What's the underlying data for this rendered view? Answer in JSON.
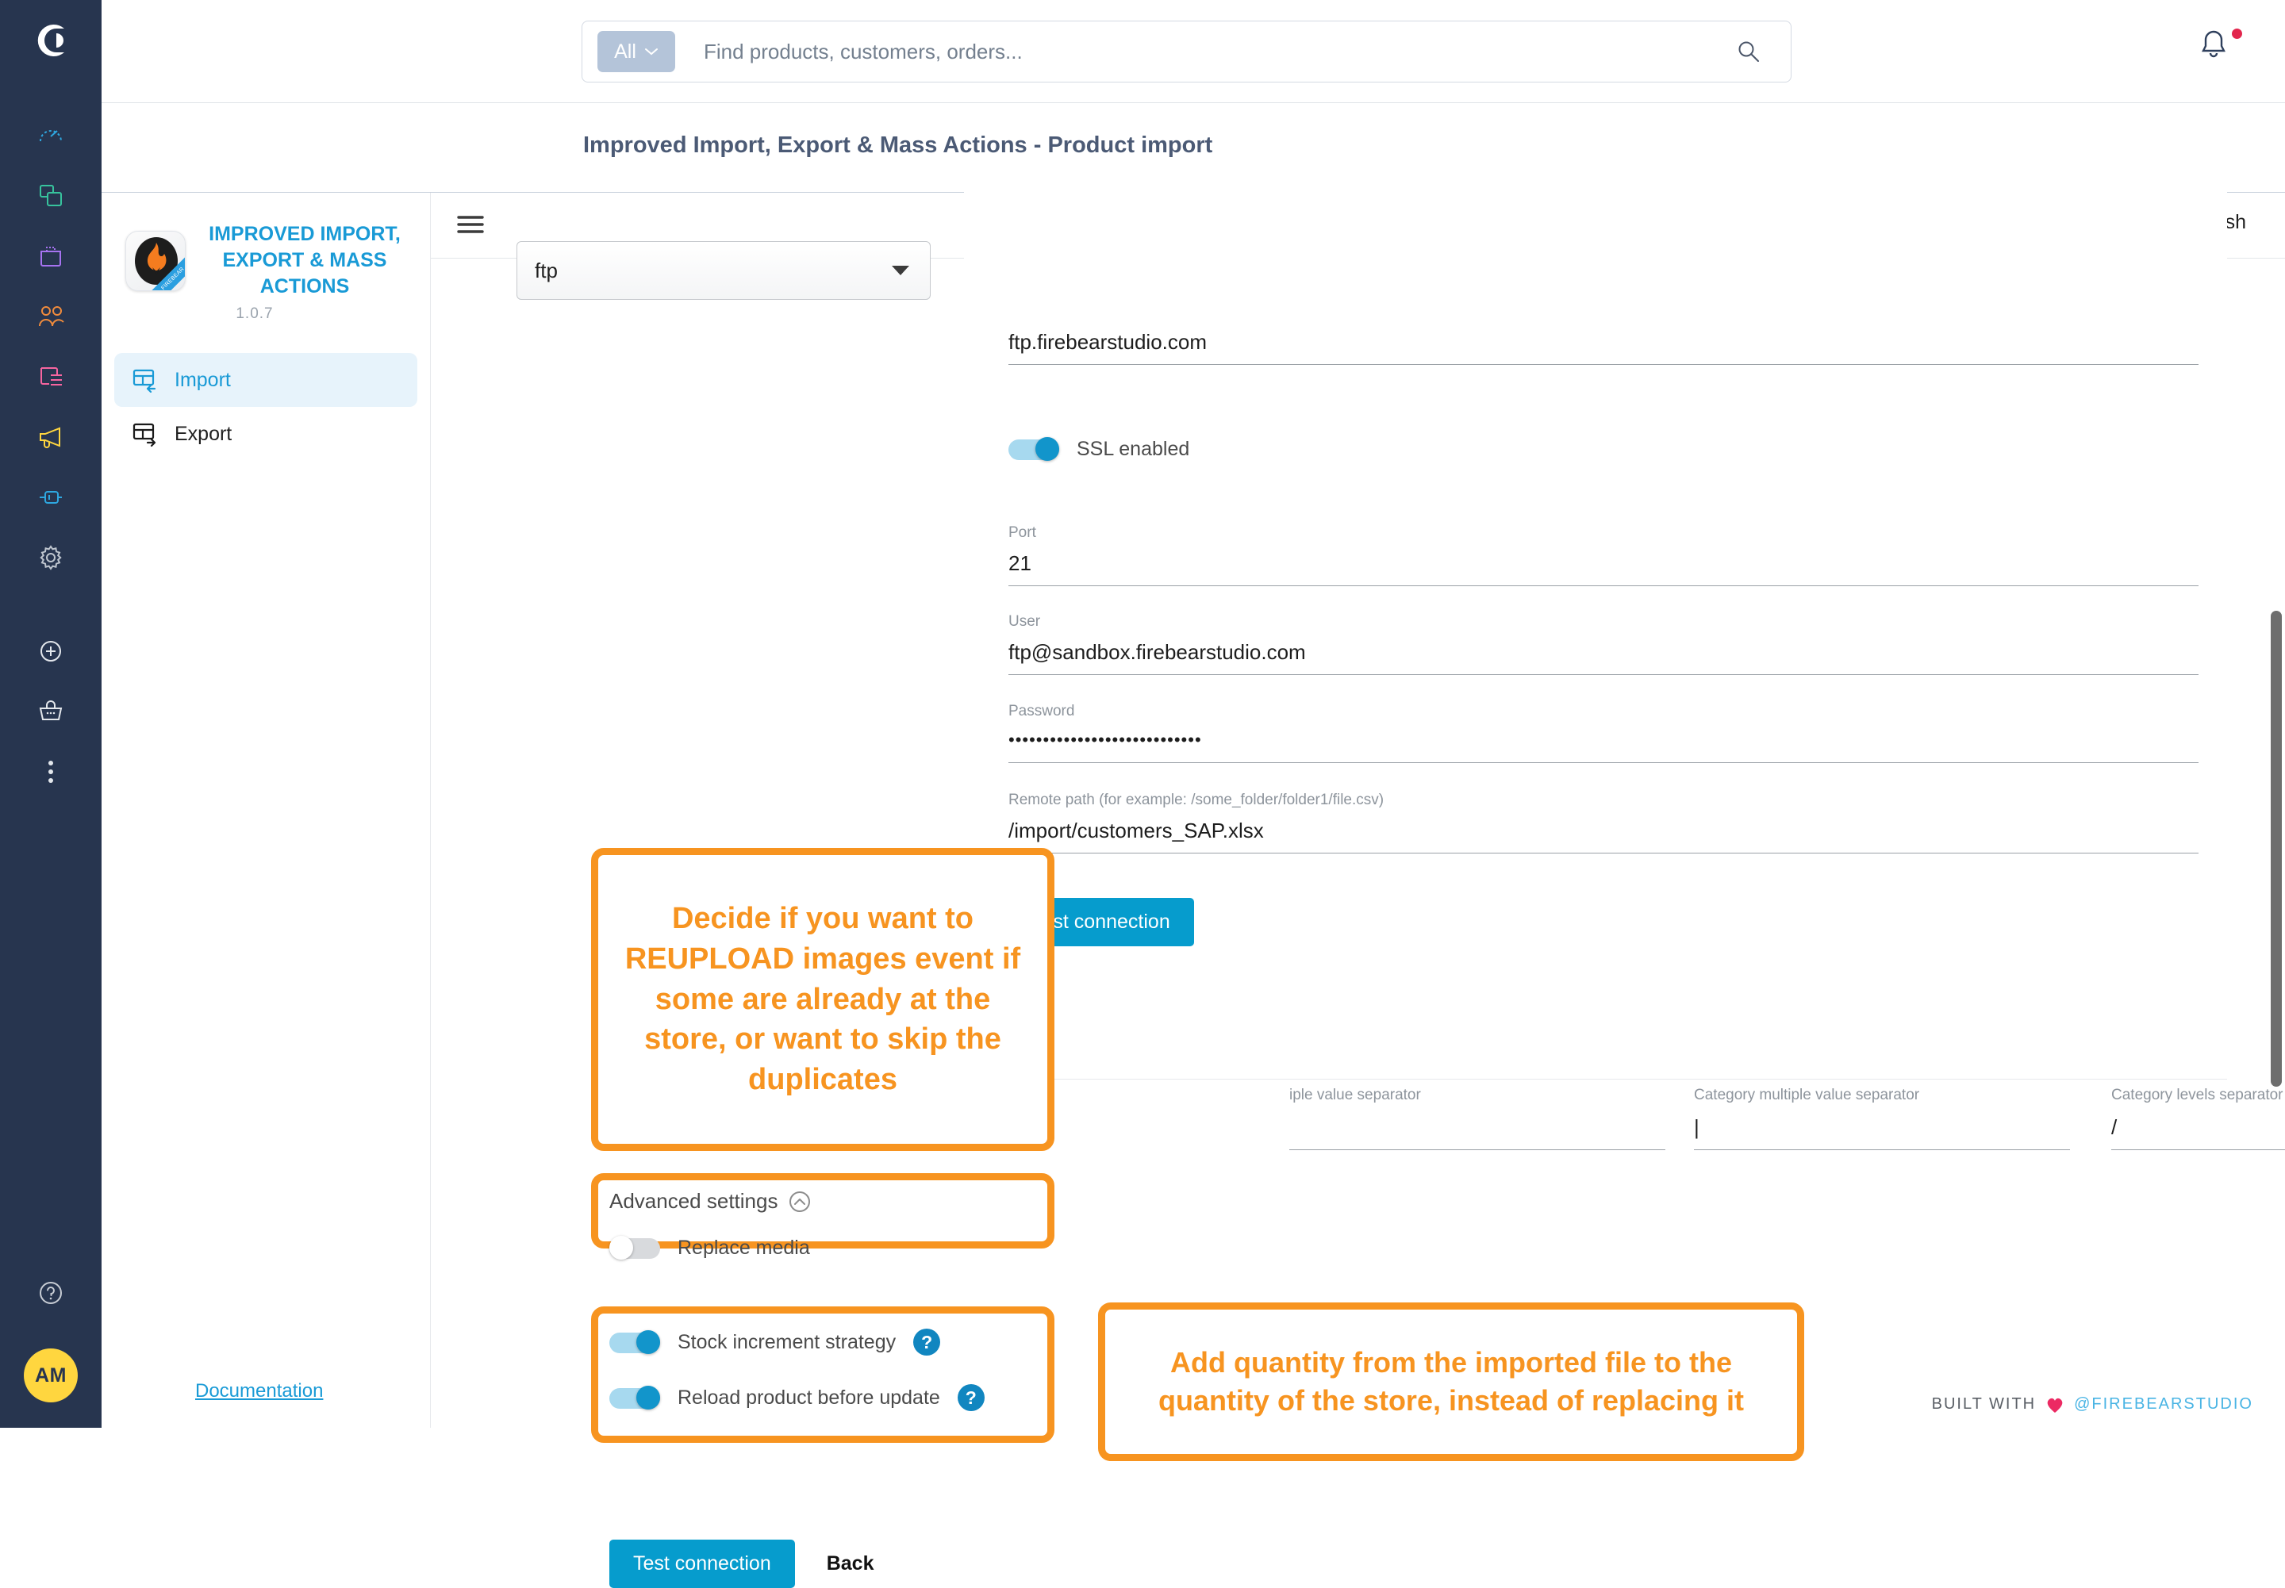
{
  "rail": {
    "logo_icon": "shopware-logo-icon",
    "avatar_initials": "AM",
    "items": [
      {
        "name": "dashboard",
        "icon": "gauge-icon",
        "color": "#2ea7e0"
      },
      {
        "name": "catalogues",
        "icon": "copy-icon",
        "color": "#37c39d"
      },
      {
        "name": "orders",
        "icon": "bag-icon",
        "color": "#a673f0"
      },
      {
        "name": "customers",
        "icon": "users-icon",
        "color": "#f08b3c"
      },
      {
        "name": "content",
        "icon": "content-icon",
        "color": "#f765a0"
      },
      {
        "name": "marketing",
        "icon": "megaphone-icon",
        "color": "#ffd63f"
      },
      {
        "name": "extensions",
        "icon": "plug-icon",
        "color": "#2ea7e0"
      },
      {
        "name": "settings",
        "icon": "gear-icon",
        "color": "#bfc6cf"
      },
      {
        "name": "add",
        "icon": "plus-circle-icon",
        "color": "#e3e7ec"
      },
      {
        "name": "shop",
        "icon": "basket-icon",
        "color": "#e3e7ec"
      },
      {
        "name": "more",
        "icon": "dots-vertical-icon",
        "color": "#e3e7ec"
      }
    ],
    "help_icon": "question-circle-icon"
  },
  "topbar": {
    "scope_label": "All",
    "scope_caret_icon": "chevron-down-icon",
    "search_placeholder": "Find products, customers, orders...",
    "search_value": "",
    "search_icon": "search-icon",
    "notifications_icon": "bell-icon",
    "has_notification": true
  },
  "header": {
    "title": "Improved Import, Export & Mass Actions - Product import"
  },
  "module_sidebar": {
    "logo_icon": "firebear-flame-icon",
    "name": "IMPROVED IMPORT, EXPORT & MASS ACTIONS",
    "version": "1.0.7",
    "nav": [
      {
        "label": "Import",
        "icon": "table-import-icon",
        "active": true
      },
      {
        "label": "Export",
        "icon": "table-export-icon",
        "active": false
      }
    ],
    "documentation_label": "Documentation"
  },
  "main_header": {
    "menu_icon": "hamburger-icon",
    "language_label": "English",
    "flag_icon": "us-flag-icon"
  },
  "source": {
    "protocol_label": "ftp",
    "protocol_caret_icon": "caret-down-icon"
  },
  "connection": {
    "host_value": "ftp.firebearstudio.com",
    "ssl": {
      "label": "SSL enabled",
      "on": true
    },
    "port": {
      "label": "Port",
      "value": "21"
    },
    "user": {
      "label": "User",
      "value": "ftp@sandbox.firebearstudio.com"
    },
    "password": {
      "label": "Password",
      "value": "••••••••••••••••••••••••••••"
    },
    "remote_path": {
      "label": "Remote path (for example: /some_folder/folder1/file.csv)",
      "value": "/import/customers_SAP.xlsx"
    },
    "test_connection_label": "Test connection"
  },
  "separators": [
    {
      "label": "iple value separator",
      "value": ""
    },
    {
      "label": "Category multiple value separator",
      "value": "|"
    },
    {
      "label": "Category levels separator",
      "value": "/"
    }
  ],
  "advanced": {
    "title": "Advanced settings",
    "collapse_icon": "chevron-up-circle-icon",
    "replace_media": {
      "label": "Replace media",
      "on": false
    }
  },
  "stock": {
    "increment": {
      "label": "Stock increment strategy",
      "on": true,
      "help_icon": "question-badge-icon"
    },
    "reload": {
      "label": "Reload product before update",
      "on": true,
      "help_icon": "question-badge-icon"
    }
  },
  "callouts": {
    "reupload": "Decide if you want to REUPLOAD images event if some are already at the store, or want to skip the duplicates",
    "quantity": "Add quantity from the imported file to the quantity of the store, instead of replacing it"
  },
  "footer_actions": {
    "test_connection_label": "Test connection",
    "back_label": "Back"
  },
  "built_with": {
    "prefix": "BUILT WITH",
    "heart_icon": "heart-icon",
    "brand": "@FIREBEARSTUDIO"
  }
}
